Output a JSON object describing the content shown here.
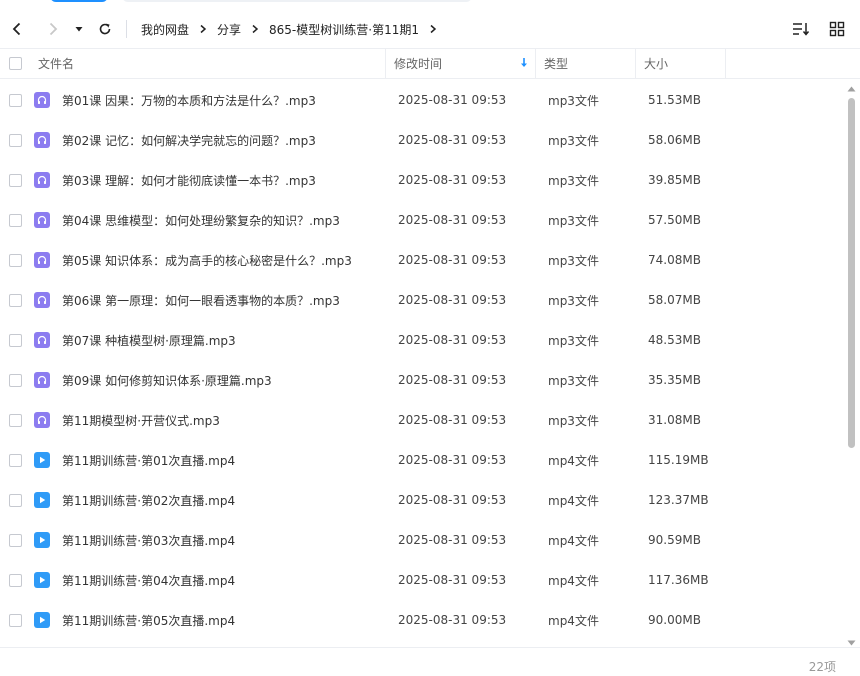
{
  "toolbar": {
    "crumbs": [
      "我的网盘",
      "分享",
      "865-模型树训练营·第11期1"
    ]
  },
  "columns": {
    "name": "文件名",
    "time": "修改时间",
    "type": "类型",
    "size": "大小"
  },
  "files": [
    {
      "name": "第01课 因果：万物的本质和方法是什么？.mp3",
      "time": "2025-08-31 09:53",
      "type": "mp3文件",
      "size": "51.53MB",
      "icon": "audio-file-icon"
    },
    {
      "name": "第02课 记忆：如何解决学完就忘的问题？.mp3",
      "time": "2025-08-31 09:53",
      "type": "mp3文件",
      "size": "58.06MB",
      "icon": "audio-file-icon"
    },
    {
      "name": "第03课 理解：如何才能彻底读懂一本书？.mp3",
      "time": "2025-08-31 09:53",
      "type": "mp3文件",
      "size": "39.85MB",
      "icon": "audio-file-icon"
    },
    {
      "name": "第04课 思维模型：如何处理纷繁复杂的知识？.mp3",
      "time": "2025-08-31 09:53",
      "type": "mp3文件",
      "size": "57.50MB",
      "icon": "audio-file-icon"
    },
    {
      "name": "第05课 知识体系：成为高手的核心秘密是什么？.mp3",
      "time": "2025-08-31 09:53",
      "type": "mp3文件",
      "size": "74.08MB",
      "icon": "audio-file-icon"
    },
    {
      "name": "第06课 第一原理：如何一眼看透事物的本质？.mp3",
      "time": "2025-08-31 09:53",
      "type": "mp3文件",
      "size": "58.07MB",
      "icon": "audio-file-icon"
    },
    {
      "name": "第07课 种植模型树·原理篇.mp3",
      "time": "2025-08-31 09:53",
      "type": "mp3文件",
      "size": "48.53MB",
      "icon": "audio-file-icon"
    },
    {
      "name": "第09课 如何修剪知识体系·原理篇.mp3",
      "time": "2025-08-31 09:53",
      "type": "mp3文件",
      "size": "35.35MB",
      "icon": "audio-file-icon"
    },
    {
      "name": "第11期模型树·开营仪式.mp3",
      "time": "2025-08-31 09:53",
      "type": "mp3文件",
      "size": "31.08MB",
      "icon": "audio-file-icon"
    },
    {
      "name": "第11期训练营·第01次直播.mp4",
      "time": "2025-08-31 09:53",
      "type": "mp4文件",
      "size": "115.19MB",
      "icon": "video-file-icon"
    },
    {
      "name": "第11期训练营·第02次直播.mp4",
      "time": "2025-08-31 09:53",
      "type": "mp4文件",
      "size": "123.37MB",
      "icon": "video-file-icon"
    },
    {
      "name": "第11期训练营·第03次直播.mp4",
      "time": "2025-08-31 09:53",
      "type": "mp4文件",
      "size": "90.59MB",
      "icon": "video-file-icon"
    },
    {
      "name": "第11期训练营·第04次直播.mp4",
      "time": "2025-08-31 09:53",
      "type": "mp4文件",
      "size": "117.36MB",
      "icon": "video-file-icon"
    },
    {
      "name": "第11期训练营·第05次直播.mp4",
      "time": "2025-08-31 09:53",
      "type": "mp4文件",
      "size": "90.00MB",
      "icon": "video-file-icon"
    }
  ],
  "footer": {
    "count": "22项"
  },
  "colors": {
    "mp3_icon": "#8c7cf0",
    "mp4_icon": "#2f9bf7",
    "accent": "#1e90ff"
  }
}
